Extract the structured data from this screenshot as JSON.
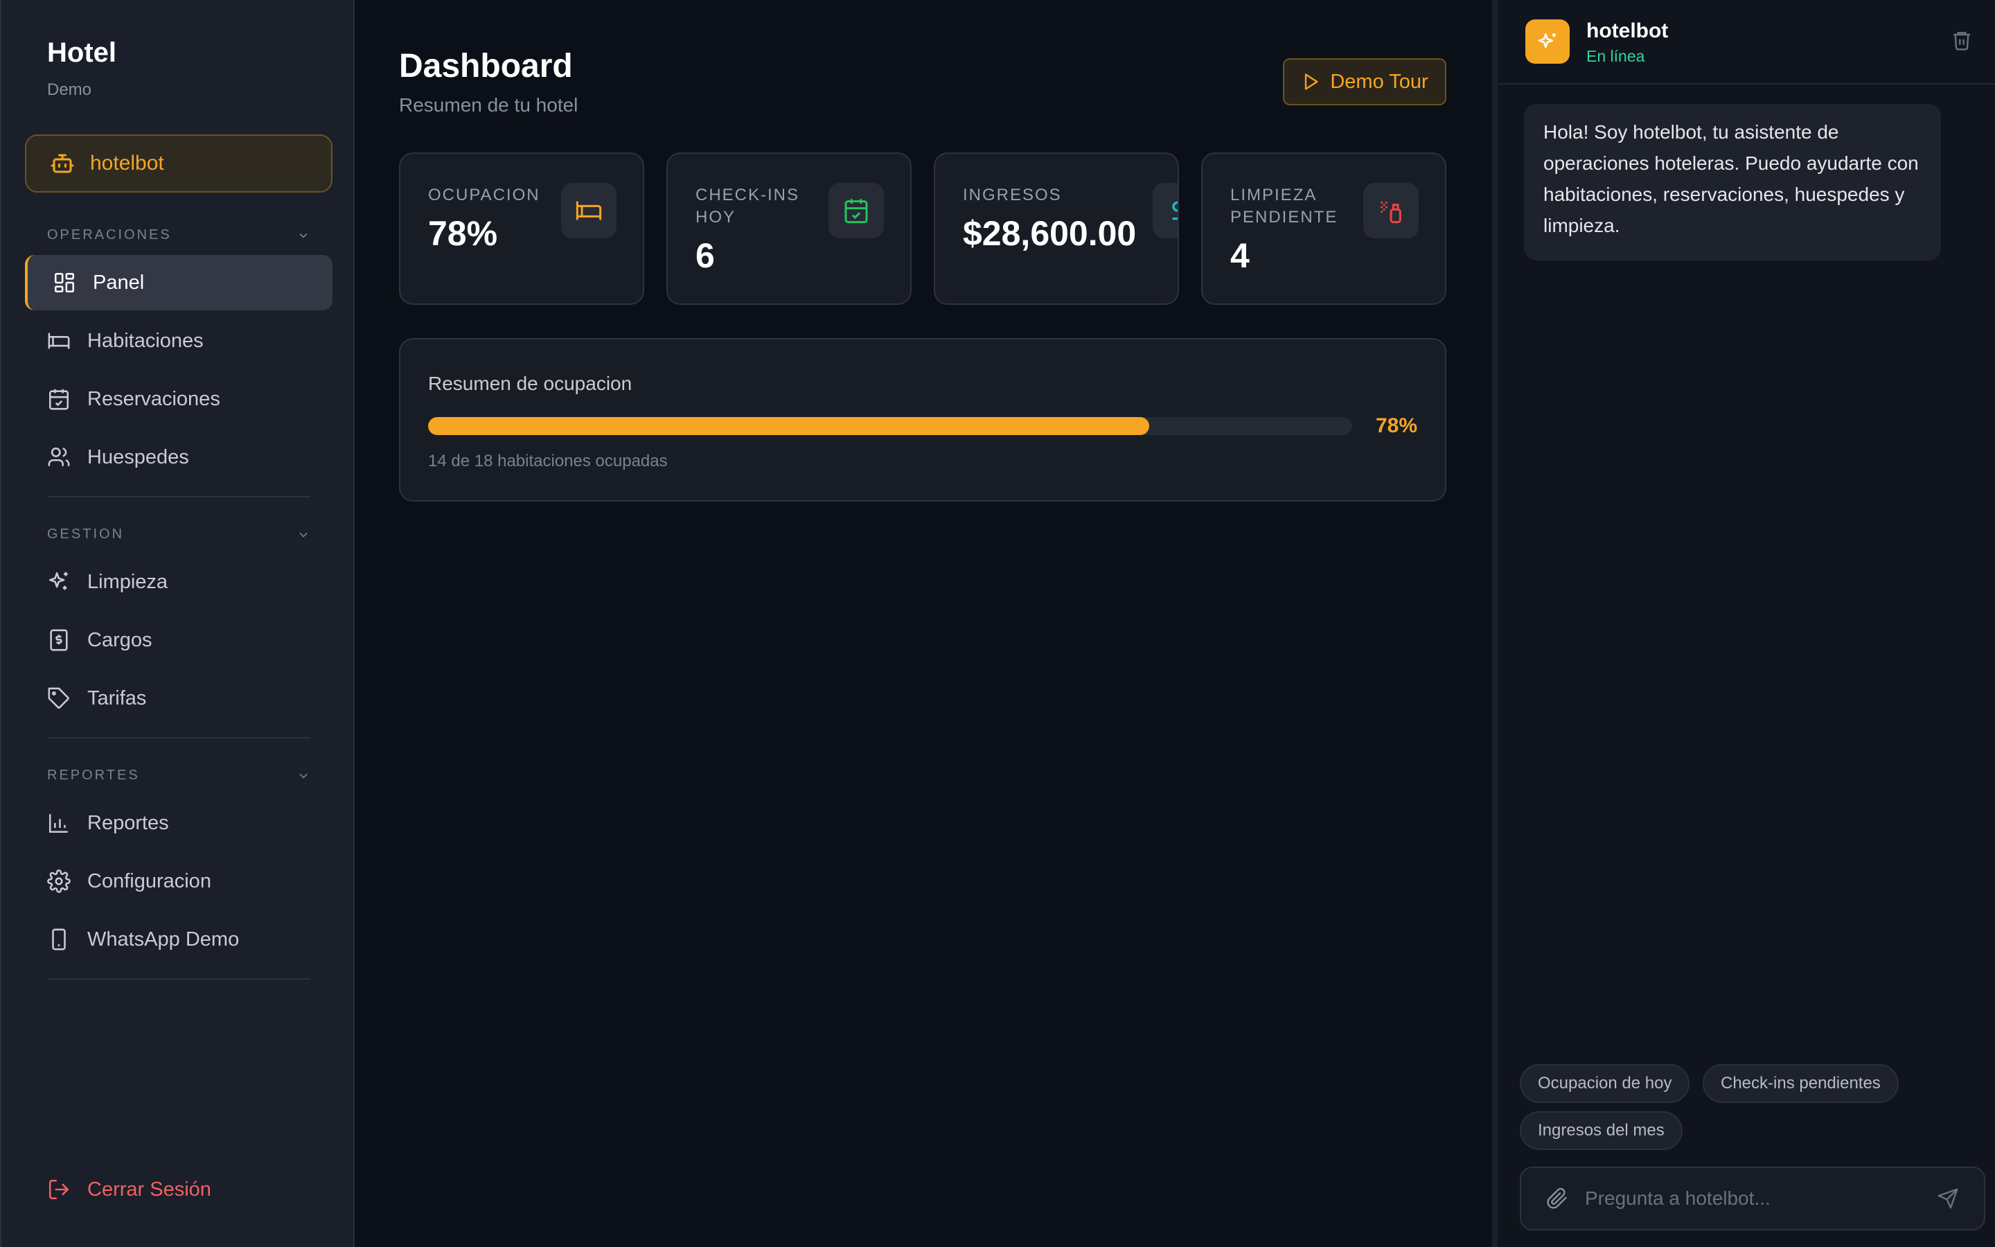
{
  "sidebar": {
    "brand_title": "Hotel",
    "brand_sub": "Demo",
    "bot_label": "hotelbot",
    "sections": {
      "operaciones": "OPERACIONES",
      "gestion": "GESTION",
      "reportes": "REPORTES"
    },
    "items": {
      "panel": "Panel",
      "habitaciones": "Habitaciones",
      "reservaciones": "Reservaciones",
      "huespedes": "Huespedes",
      "limpieza": "Limpieza",
      "cargos": "Cargos",
      "tarifas": "Tarifas",
      "reportes": "Reportes",
      "configuracion": "Configuracion",
      "whatsapp": "WhatsApp Demo"
    },
    "logout": "Cerrar Sesión",
    "active_item": "panel"
  },
  "header": {
    "title": "Dashboard",
    "subtitle": "Resumen de tu hotel",
    "tour_button": "Demo Tour"
  },
  "stats": [
    {
      "label": "OCUPACION",
      "value": "78%",
      "icon": "bed-icon",
      "color": "#f5a623"
    },
    {
      "label": "CHECK-INS HOY",
      "value": "6",
      "icon": "calendar-check-icon",
      "color": "#22c55e"
    },
    {
      "label": "INGRESOS",
      "value": "$28,600.00",
      "icon": "dollar-icon",
      "color": "#22b8cf"
    },
    {
      "label": "LIMPIEZA PENDIENTE",
      "value": "4",
      "icon": "spray-icon",
      "color": "#ef4444"
    }
  ],
  "occupancy": {
    "title": "Resumen de ocupacion",
    "percent_label": "78%",
    "fraction": 0.78,
    "note": "14 de 18 habitaciones ocupadas",
    "color": "#f5a623"
  },
  "chat": {
    "name": "hotelbot",
    "status": "En línea",
    "message": "Hola! Soy hotelbot, tu asistente de operaciones hoteleras. Puedo ayudarte con habitaciones, reservaciones, huespedes y limpieza.",
    "suggestions": [
      "Ocupacion de hoy",
      "Check-ins pendientes",
      "Ingresos del mes"
    ],
    "placeholder": "Pregunta a hotelbot..."
  },
  "colors": {
    "accent": "#f5a623",
    "online": "#34d399",
    "danger": "#f06262"
  }
}
